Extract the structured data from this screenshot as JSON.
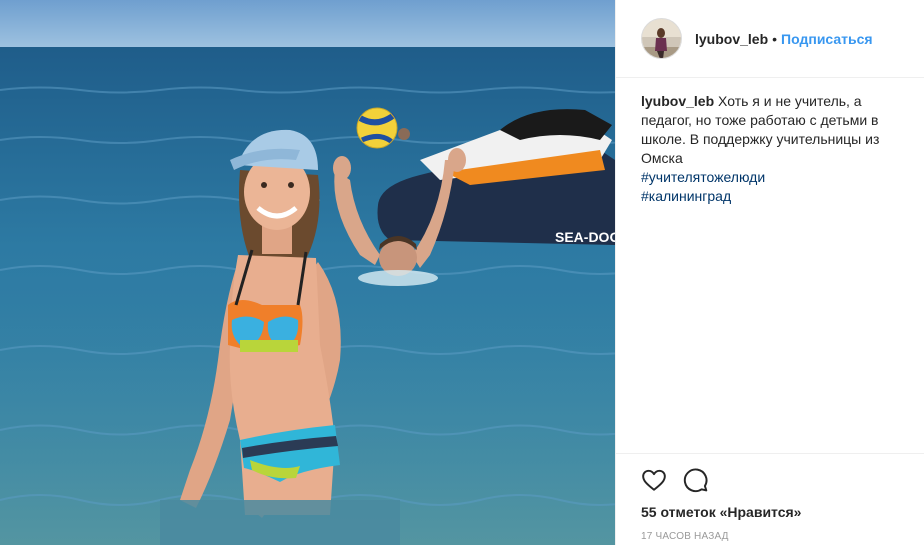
{
  "header": {
    "username": "lyubov_leb",
    "separator": "•",
    "follow_label": "Подписаться"
  },
  "caption": {
    "username": "lyubov_leb",
    "text": "Хоть я и не учитель, а педагог, но тоже работаю с детьми в школе. В поддержку учительницы из Омска",
    "hashtags": [
      "#учителятожелюди",
      "#калининград"
    ]
  },
  "photo": {
    "jetski_brand": "SEA-DOO"
  },
  "actions": {
    "like_icon": "heart-icon",
    "comment_icon": "comment-icon"
  },
  "likes_text": "55 отметок «Нравится»",
  "timestamp": "17 часов назад",
  "colors": {
    "link_blue": "#3897f0",
    "hashtag_blue": "#003569",
    "text": "#262626",
    "muted": "#999999"
  }
}
